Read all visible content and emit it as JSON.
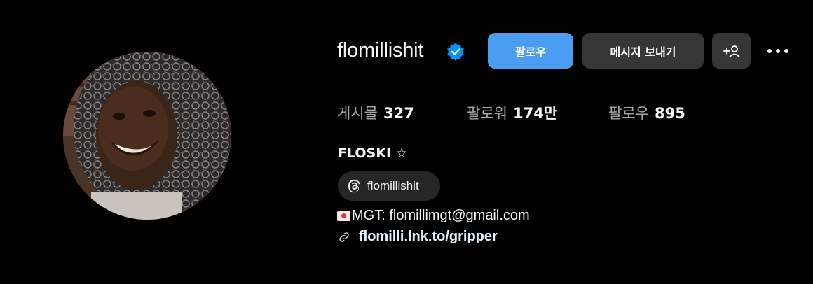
{
  "profile": {
    "username": "flomillishit",
    "full_name": "FLOSKI ☆",
    "verified": true
  },
  "actions": {
    "follow_label": "팔로우",
    "message_label": "메시지 보내기",
    "suggest_label": "+⁠"
  },
  "stats": {
    "posts_label": "게시물",
    "posts_value": "327",
    "followers_label": "팔로워",
    "followers_value": "174만",
    "following_label": "팔로우",
    "following_value": "895"
  },
  "bio": {
    "threads_handle": "flomillishit",
    "contact_line": "MGT: flomillimgt@gmail.com",
    "link": "flomilli.lnk.to/gripper"
  },
  "colors": {
    "background": "#000000",
    "follow_button": "#4a9df0",
    "secondary_button": "#363636",
    "verified_badge": "#0095f6",
    "link": "#e0f1ff"
  },
  "icons": {
    "verified": "verified-badge-icon",
    "suggest": "add-person-icon",
    "more": "more-options-icon",
    "threads": "threads-logo-icon",
    "contact": "love-letter-icon",
    "link": "link-chain-icon"
  }
}
